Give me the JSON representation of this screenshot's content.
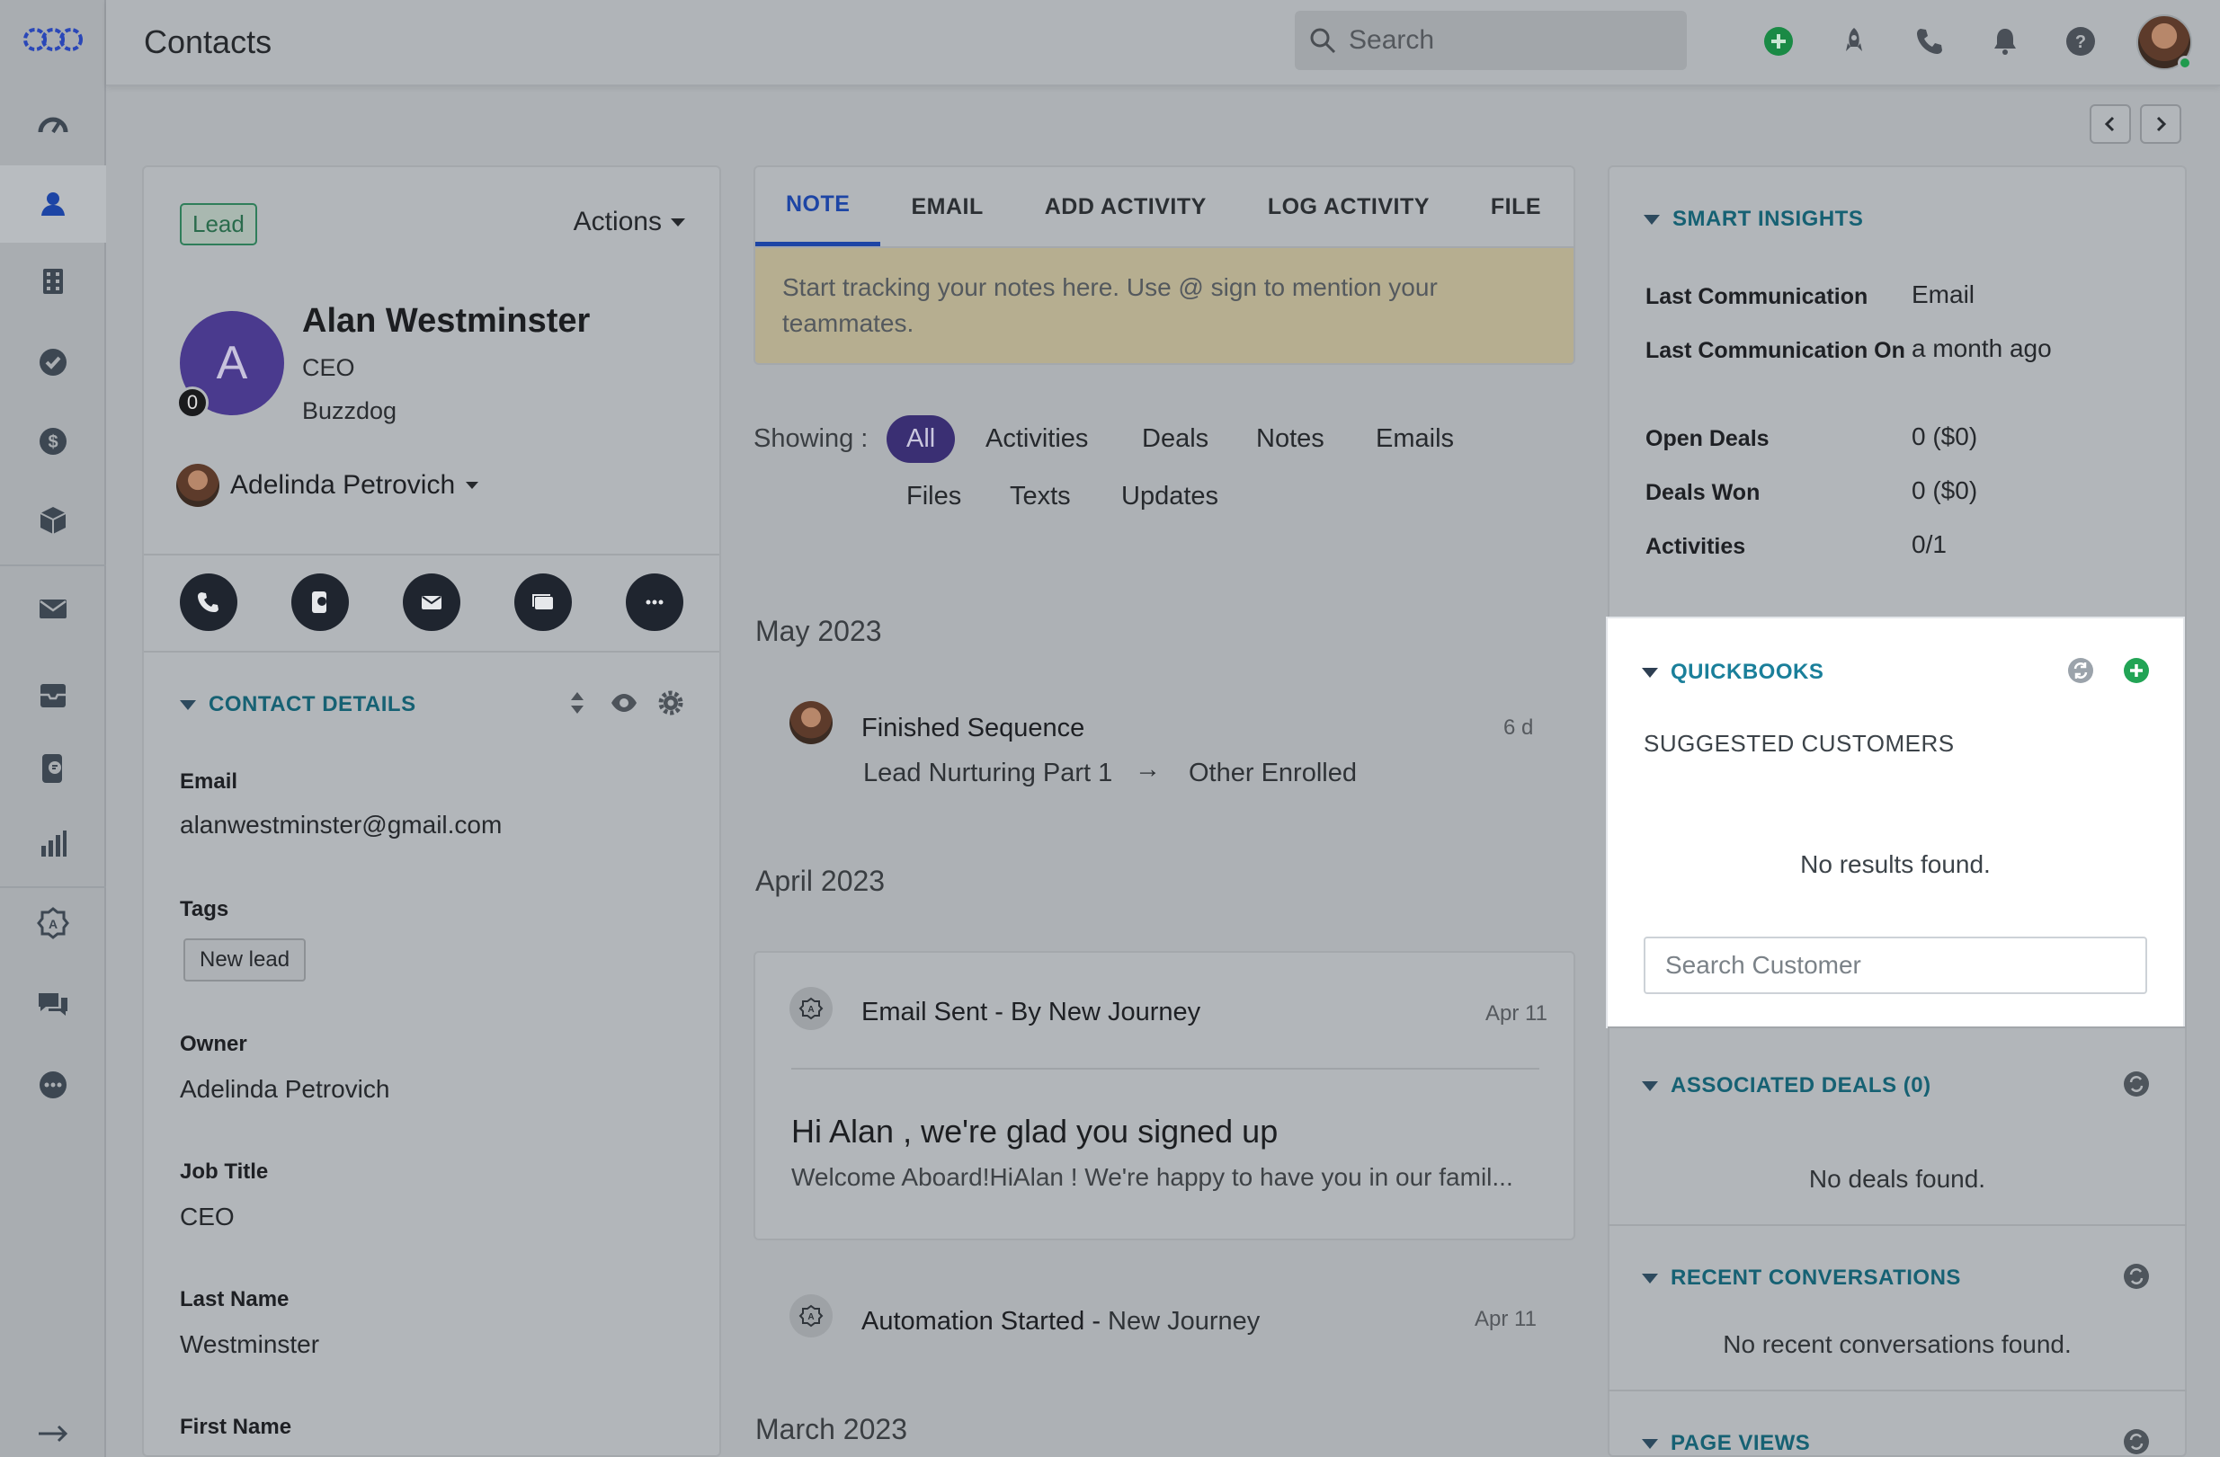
{
  "header": {
    "title": "Contacts",
    "search_placeholder": "Search"
  },
  "sidebar": {
    "items": [
      "dashboard-icon",
      "contacts-icon",
      "companies-icon",
      "tasks-icon",
      "deals-icon",
      "products-icon",
      "email-icon",
      "inbox-icon",
      "phone-log-icon",
      "reports-icon",
      "automation-icon",
      "chat-icon",
      "more-icon"
    ],
    "expand_icon": "arrow-right-icon"
  },
  "contact": {
    "badge": "Lead",
    "actions_label": "Actions",
    "avatar_initial": "A",
    "avatar_count": "0",
    "name": "Alan Westminster",
    "title": "CEO",
    "company": "Buzzdog",
    "owner": "Adelinda Petrovich"
  },
  "contact_details": {
    "heading": "CONTACT DETAILS",
    "fields": [
      {
        "label": "Email",
        "value": "alanwestminster@gmail.com"
      },
      {
        "label": "Tags",
        "value": "New lead"
      },
      {
        "label": "Owner",
        "value": "Adelinda Petrovich"
      },
      {
        "label": "Job Title",
        "value": "CEO"
      },
      {
        "label": "Last Name",
        "value": "Westminster"
      },
      {
        "label": "First Name",
        "value": ""
      }
    ]
  },
  "tabs": [
    "NOTE",
    "EMAIL",
    "ADD ACTIVITY",
    "LOG ACTIVITY",
    "FILE"
  ],
  "note_placeholder": "Start tracking your notes here. Use @ sign to mention your teammates.",
  "showing": {
    "label": "Showing :",
    "filters": [
      "All",
      "Activities",
      "Deals",
      "Notes",
      "Emails",
      "Files",
      "Texts",
      "Updates"
    ]
  },
  "timeline": {
    "months": [
      "May 2023",
      "April 2023",
      "March 2023"
    ],
    "item1": {
      "title": "Finished Sequence",
      "time": "6 d",
      "from": "Lead Nurturing Part 1",
      "arrow": "→",
      "to": "Other Enrolled"
    },
    "item2": {
      "title": "Email Sent - By New Journey",
      "time": "Apr 11",
      "subject": "Hi Alan , we're glad you signed up",
      "preview": "Welcome Aboard!HiAlan ! We're happy to have you in our famil..."
    },
    "item3": {
      "title_bold": "Automation Started - ",
      "title_rest": "New Journey",
      "time": "Apr 11"
    }
  },
  "smart_insights": {
    "heading": "SMART INSIGHTS",
    "rows": [
      {
        "label": "Last Communication",
        "value": "Email"
      },
      {
        "label": "Last Communication On",
        "value": "a month ago"
      },
      {
        "label": "Open Deals",
        "value": "0 ($0)"
      },
      {
        "label": "Deals Won",
        "value": "0 ($0)"
      },
      {
        "label": "Activities",
        "value": "0/1"
      }
    ]
  },
  "quickbooks": {
    "heading": "QUICKBOOKS",
    "subheading": "SUGGESTED CUSTOMERS",
    "empty": "No results found.",
    "search_placeholder": "Search Customer"
  },
  "associated_deals": {
    "heading": "ASSOCIATED DEALS (0)",
    "empty": "No deals found."
  },
  "recent_conversations": {
    "heading": "RECENT CONVERSATIONS",
    "empty": "No recent conversations found."
  },
  "page_views": {
    "heading": "PAGE VIEWS"
  },
  "colors": {
    "accent": "#1d45a5",
    "teal": "#1a7f9a",
    "green": "#1f9a4d",
    "purple": "#3a2f73"
  }
}
